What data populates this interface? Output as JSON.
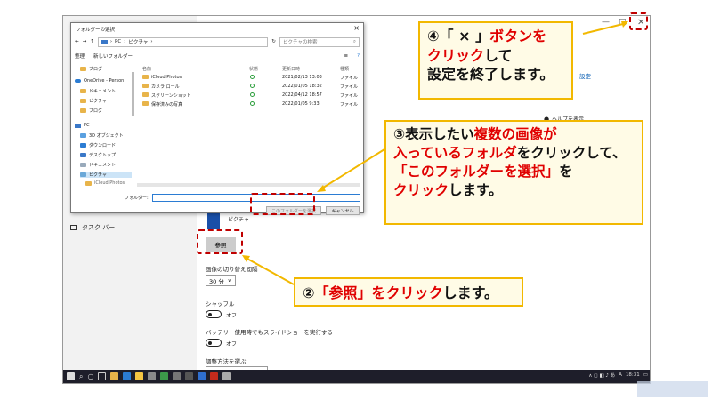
{
  "settings": {
    "taskbar_label": "タスク バー",
    "picture_label": "ピクチャ",
    "browse_label": "参照",
    "interval_label": "画像の切り替え間隔",
    "interval_value": "30 分",
    "shuffle_label": "シャッフル",
    "shuffle_state": "オフ",
    "battery_label": "バッテリー使用時でもスライドショーを実行する",
    "battery_state": "オフ",
    "fit_label": "調整方法を選ぶ",
    "help_label": "ヘルプを表示",
    "link_fragment": "設定"
  },
  "dialog": {
    "title": "フォルダーの選択",
    "breadcrumb_pc": "PC",
    "breadcrumb_pictures": "ピクチャ",
    "search_placeholder": "ピクチャの検索",
    "organize": "整理",
    "new_folder": "新しいフォルダー",
    "columns": {
      "name": "名前",
      "status": "状態",
      "date": "更新日時",
      "type": "種類"
    },
    "sidebar": [
      {
        "label": "ブログ",
        "icon": "folder-icon"
      },
      {
        "label": "OneDrive - Person",
        "icon": "cloud-icon"
      },
      {
        "label": "ドキュメント",
        "icon": "folder-icon"
      },
      {
        "label": "ピクチャ",
        "icon": "folder-icon"
      },
      {
        "label": "ブログ",
        "icon": "folder-icon"
      },
      {
        "label": "PC",
        "icon": "pc-icon"
      },
      {
        "label": "3D オブジェクト",
        "icon": "folder-icon"
      },
      {
        "label": "ダウンロード",
        "icon": "folder-icon"
      },
      {
        "label": "デスクトップ",
        "icon": "folder-icon"
      },
      {
        "label": "ドキュメント",
        "icon": "folder-icon"
      },
      {
        "label": "ピクチャ",
        "icon": "folder-icon"
      },
      {
        "label": "iCloud Photos",
        "icon": "folder-icon"
      }
    ],
    "files": [
      {
        "name": "iCloud Photos",
        "date": "2021/02/13 13:03",
        "type": "ファイル"
      },
      {
        "name": "カメラ ロール",
        "date": "2022/01/05 18:32",
        "type": "ファイル"
      },
      {
        "name": "スクリーンショット",
        "date": "2022/04/12 18:57",
        "type": "ファイル"
      },
      {
        "name": "保存済みの写真",
        "date": "2022/01/05 9:33",
        "type": "ファイル"
      }
    ],
    "folder_label": "フォルダー:",
    "select_button": "このフォルダーを選択",
    "cancel_button": "キャンセル"
  },
  "callouts": {
    "c4_line1_pre": "④「 × 」",
    "c4_line1_red": "ボタンを",
    "c4_line2_red": "クリック",
    "c4_line2_post": "して",
    "c4_line3": "設定を終了します。",
    "c3_line1_pre": "③表示したい",
    "c3_line1_red": "複数の画像が",
    "c3_line2_red": "入っているフォルダ",
    "c3_line2_post": "をクリックして、",
    "c3_line3_red": "「このフォルダーを選択」",
    "c3_line3_post": "を",
    "c3_line4_red": "クリック",
    "c3_line4_post": "します。",
    "c2_pre": "②",
    "c2_red": "「参照」をクリック",
    "c2_post": "します。"
  },
  "taskbar": {
    "time": "18:31",
    "lang": "A"
  },
  "colors": {
    "callout_border": "#f2b800",
    "callout_bg": "#fffbe6",
    "highlight_red": "#e00000",
    "dash_red": "#c00000"
  }
}
